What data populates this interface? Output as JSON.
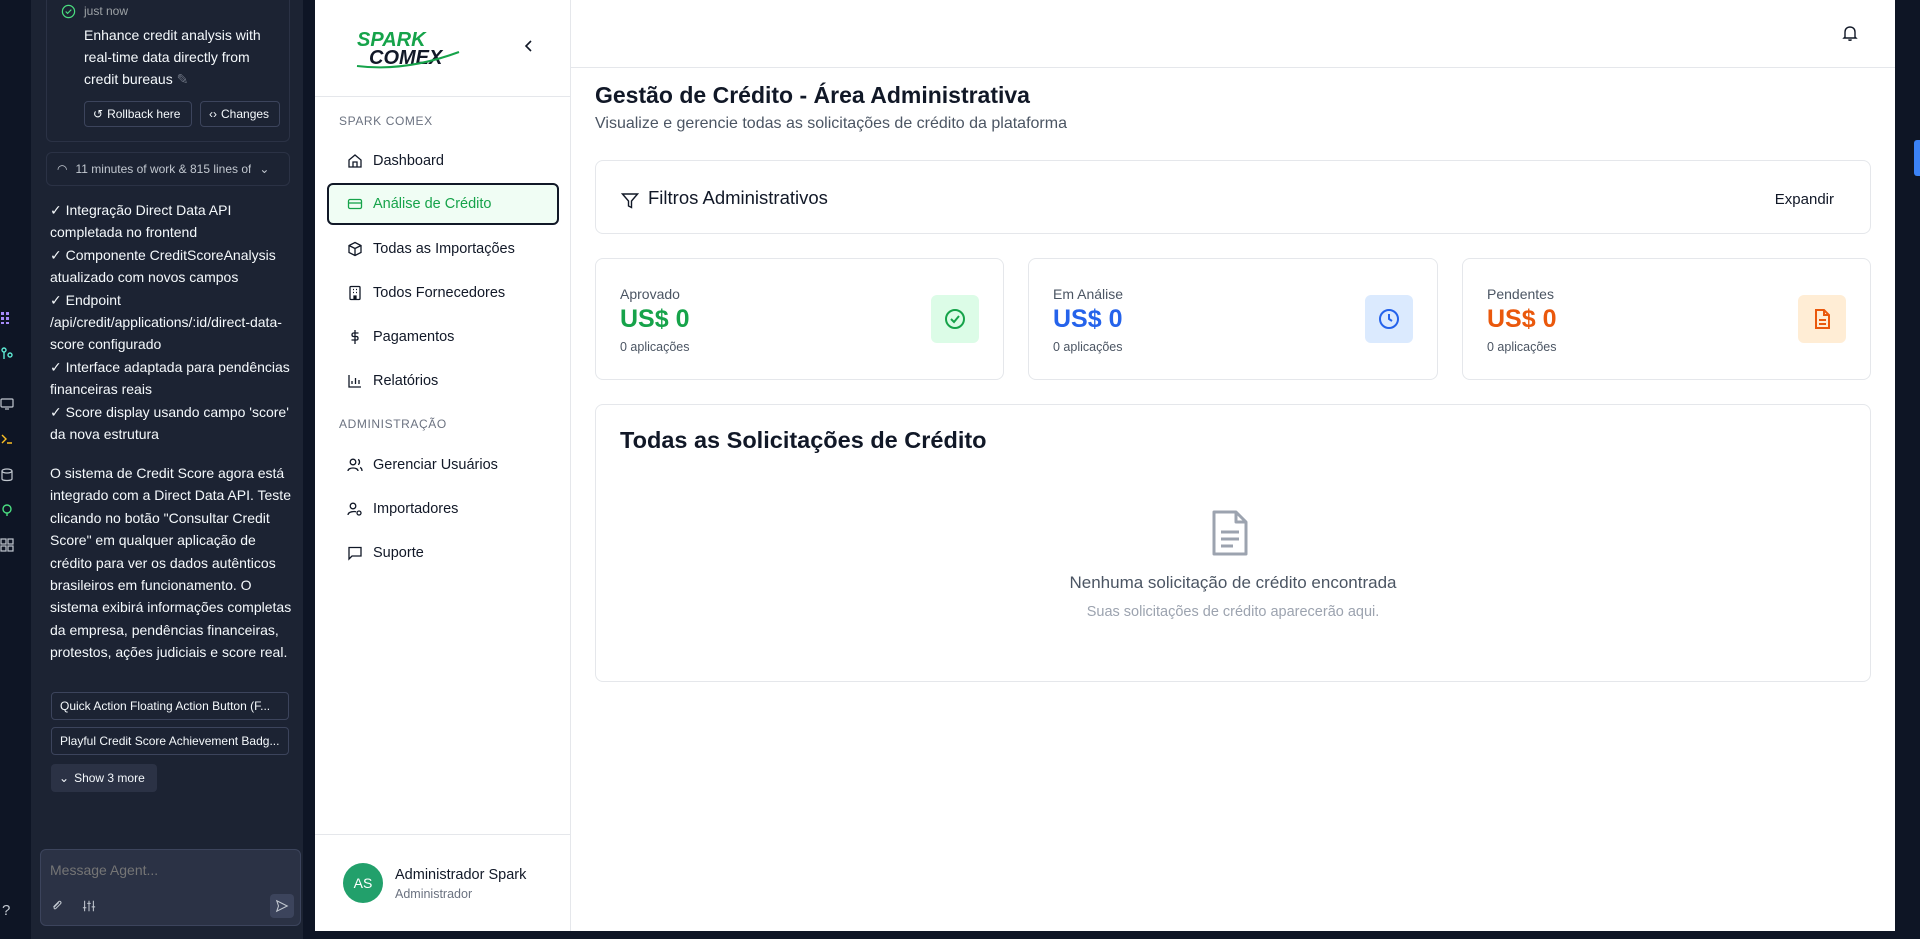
{
  "agent": {
    "checkpoint": {
      "time": "just now",
      "text": "Enhance credit analysis with real-time data directly from credit bureaus",
      "rollback_label": "Rollback here",
      "changes_label": "Changes"
    },
    "work_summary": "11 minutes of work & 815 lines of",
    "message_lines": [
      "✓ Integração Direct Data API completada no frontend",
      "✓ Componente CreditScoreAnalysis atualizado com novos campos",
      "✓ Endpoint /api/credit/applications/:id/direct-data-score configurado",
      "✓ Interface adaptada para pendências financeiras reais",
      "✓ Score display usando campo 'score' da nova estrutura"
    ],
    "message_paragraph": "O sistema de Credit Score agora está integrado com a Direct Data API. Teste clicando no botão \"Consultar Credit Score\" em qualquer aplicação de crédito para ver os dados autênticos brasileiros em funcionamento. O sistema exibirá informações completas da empresa, pendências financeiras, protestos, ações judiciais e score real.",
    "suggestions": [
      "Quick Action Floating Action Button (F...",
      "Playful Credit Score Achievement Badg..."
    ],
    "show_more": "Show 3 more",
    "composer_placeholder": "Message Agent...",
    "help": "?"
  },
  "sidebar": {
    "logo_text_top": "SPARK",
    "logo_text_bottom": "COMEX",
    "section_main": "SPARK COMEX",
    "items": [
      {
        "label": "Dashboard",
        "icon": "home-icon"
      },
      {
        "label": "Análise de Crédito",
        "icon": "credit-card-icon",
        "active": true
      },
      {
        "label": "Todas as Importações",
        "icon": "package-icon"
      },
      {
        "label": "Todos Fornecedores",
        "icon": "building-icon"
      },
      {
        "label": "Pagamentos",
        "icon": "dollar-icon"
      },
      {
        "label": "Relatórios",
        "icon": "bar-chart-icon"
      }
    ],
    "section_admin": "ADMINISTRAÇÃO",
    "admin_items": [
      {
        "label": "Gerenciar Usuários",
        "icon": "users-icon"
      },
      {
        "label": "Importadores",
        "icon": "user-cog-icon"
      },
      {
        "label": "Suporte",
        "icon": "message-icon"
      }
    ],
    "user": {
      "initials": "AS",
      "name": "Administrador Spark",
      "role": "Administrador"
    }
  },
  "main": {
    "title": "Gestão de Crédito - Área Administrativa",
    "subtitle": "Visualize e gerencie todas as solicitações de crédito da plataforma",
    "filters": {
      "title": "Filtros Administrativos",
      "expand": "Expandir"
    },
    "stats": [
      {
        "label": "Aprovado",
        "value": "US$ 0",
        "count": "0 aplicações",
        "color": "#16a34a",
        "icon_bg": "#dcfce7",
        "icon": "check-circle-icon"
      },
      {
        "label": "Em Análise",
        "value": "US$ 0",
        "count": "0 aplicações",
        "color": "#2563eb",
        "icon_bg": "#dbeafe",
        "icon": "clock-icon"
      },
      {
        "label": "Pendentes",
        "value": "US$ 0",
        "count": "0 aplicações",
        "color": "#ea580c",
        "icon_bg": "#ffedd5",
        "icon": "file-icon"
      }
    ],
    "list": {
      "title": "Todas as Solicitações de Crédito",
      "empty_title": "Nenhuma solicitação de crédito encontrada",
      "empty_sub": "Suas solicitações de crédito aparecerão aqui."
    }
  }
}
